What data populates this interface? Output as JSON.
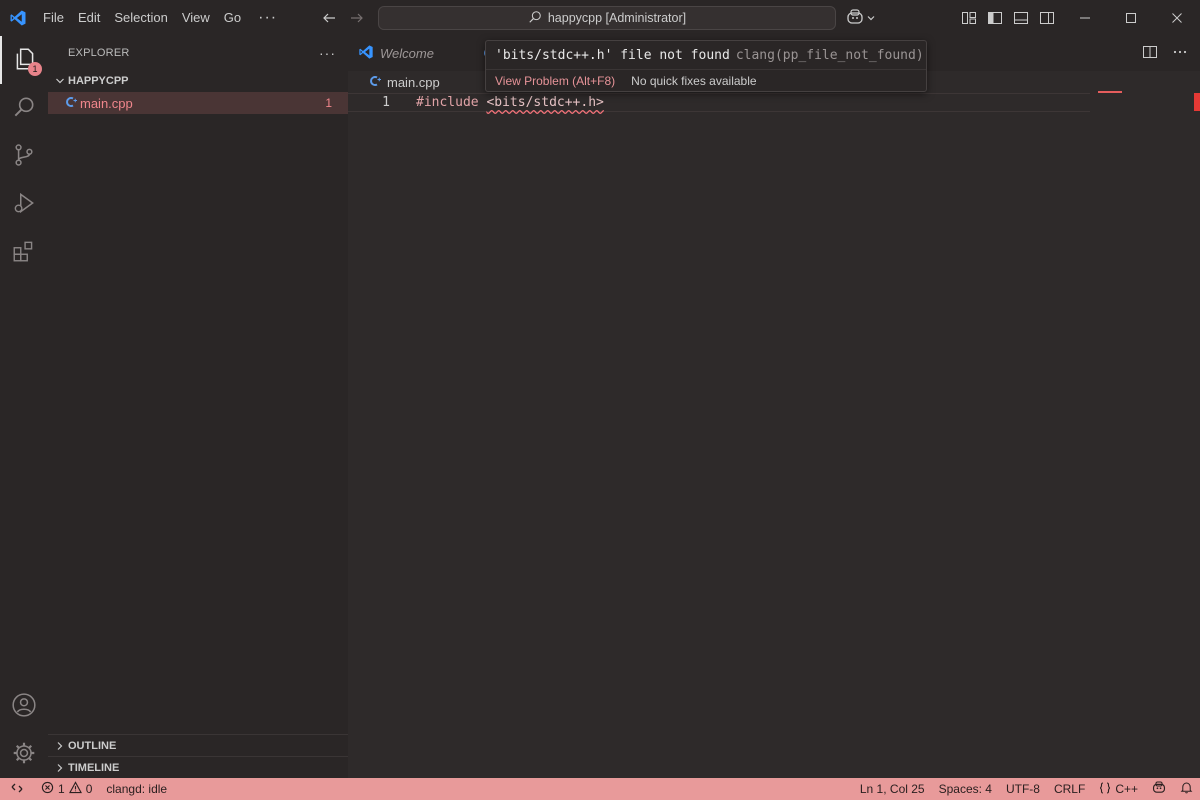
{
  "titlebar": {
    "menu": [
      "File",
      "Edit",
      "Selection",
      "View",
      "Go"
    ],
    "more": "···",
    "command_center": "happycpp [Administrator]"
  },
  "activity": {
    "explorer_badge": "1"
  },
  "sidebar": {
    "title": "EXPLORER",
    "more": "···",
    "project": "HAPPYCPP",
    "files": [
      {
        "name": "main.cpp",
        "problems": "1"
      }
    ],
    "sections": [
      "OUTLINE",
      "TIMELINE"
    ]
  },
  "editor": {
    "tabs": [
      {
        "label": "Welcome"
      }
    ],
    "breadcrumb": "main.cpp",
    "lines": [
      {
        "number": "1",
        "directive": "#include",
        "space": " ",
        "header": "<bits/stdc++.h>"
      }
    ]
  },
  "hover": {
    "message": "'bits/stdc++.h' file not found",
    "code": "clang(pp_file_not_found)",
    "view_problem": "View Problem (Alt+F8)",
    "no_fixes": "No quick fixes available"
  },
  "statusbar": {
    "errors": "1",
    "warnings": "0",
    "clangd": "clangd: idle",
    "position": "Ln 1, Col 25",
    "spaces": "Spaces: 4",
    "encoding": "UTF-8",
    "eol": "CRLF",
    "language": "C++"
  },
  "colors": {
    "accent": "#e89a9a",
    "error": "#f0868c",
    "background": "#2e2a2a",
    "vscode_blue": "#3794ff"
  }
}
